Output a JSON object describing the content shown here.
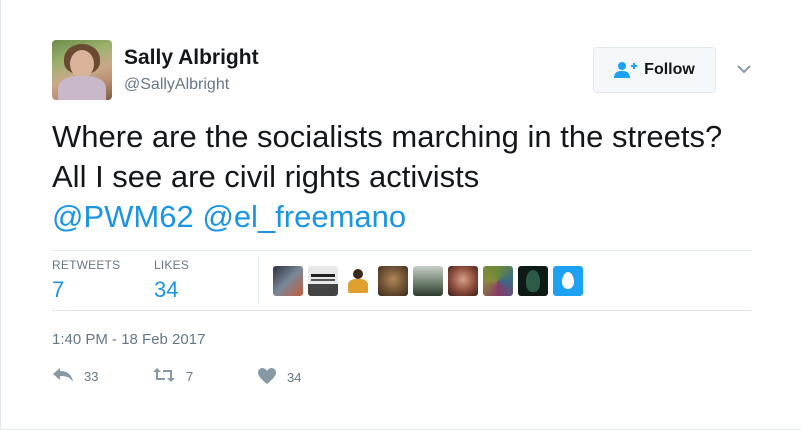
{
  "author": {
    "name": "Sally Albright",
    "handle": "@SallyAlbright"
  },
  "follow_button": {
    "label": "Follow"
  },
  "tweet": {
    "text": "Where are the socialists marching in the streets? All I see are civil rights activists",
    "mentions": [
      "@PWM62",
      "@el_freemano"
    ]
  },
  "stats": {
    "retweets_label": "RETWEETS",
    "retweets_count": "7",
    "likes_label": "LIKES",
    "likes_count": "34"
  },
  "likers": [
    {
      "icon": "liker-avatar-1"
    },
    {
      "icon": "liker-avatar-2"
    },
    {
      "icon": "liker-avatar-3"
    },
    {
      "icon": "liker-avatar-4"
    },
    {
      "icon": "liker-avatar-5"
    },
    {
      "icon": "liker-avatar-6"
    },
    {
      "icon": "liker-avatar-7"
    },
    {
      "icon": "liker-avatar-8"
    },
    {
      "icon": "liker-avatar-9"
    }
  ],
  "timestamp": "1:40 PM - 18 Feb 2017",
  "actions": {
    "reply_count": "33",
    "retweet_count": "7",
    "like_count": "34"
  },
  "colors": {
    "link_blue": "#1b95e0",
    "twitter_blue": "#1da1f2",
    "secondary_text": "#657786",
    "border": "#e1e8ed",
    "egg_avatar_bg": "#1da1f2"
  }
}
